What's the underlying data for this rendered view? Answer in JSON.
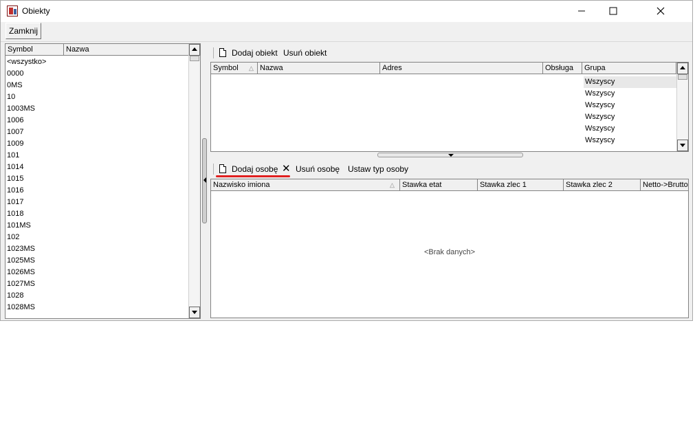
{
  "window": {
    "title": "Obiekty",
    "controls": {
      "minimize": "minimize-icon",
      "maximize": "maximize-icon",
      "close": "close-icon"
    }
  },
  "toolbar": {
    "close_label": "Zamknij"
  },
  "left_list": {
    "columns": [
      "Symbol",
      "Nazwa"
    ],
    "items": [
      "<wszystko>",
      "0000",
      "0MS",
      "10",
      "1003MS",
      "1006",
      "1007",
      "1009",
      "101",
      "1014",
      "1015",
      "1016",
      "1017",
      "1018",
      "101MS",
      "102",
      "1023MS",
      "1025MS",
      "1026MS",
      "1027MS",
      "1028",
      "1028MS"
    ]
  },
  "objects_panel": {
    "add_label": "Dodaj obiekt",
    "remove_label": "Usuń obiekt",
    "columns": [
      "Symbol",
      "Nazwa",
      "Adres",
      "Obsługa",
      "Grupa"
    ],
    "groups": [
      "Wszyscy",
      "Wszyscy",
      "Wszyscy",
      "Wszyscy",
      "Wszyscy",
      "Wszyscy"
    ]
  },
  "persons_panel": {
    "add_label": "Dodaj osobę",
    "remove_label": "Usuń osobę",
    "set_type_label": "Ustaw typ osoby",
    "columns": [
      "Nazwisko imiona",
      "Stawka etat",
      "Stawka zlec 1",
      "Stawka zlec 2",
      "Netto->Brutto"
    ],
    "empty_text": "<Brak danych>"
  },
  "colors": {
    "highlight_underline": "#e02020",
    "window_bg": "#f0f0f0",
    "grid_border": "#828282"
  }
}
